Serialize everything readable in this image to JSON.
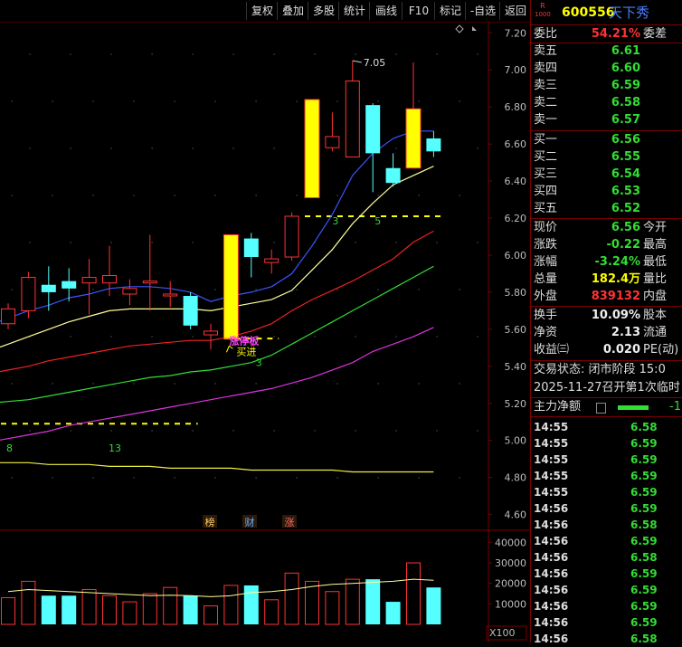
{
  "toolbar": {
    "items": [
      "复权",
      "叠加",
      "多股",
      "统计",
      "画线",
      "F10",
      "标记",
      "-自选",
      "返回"
    ]
  },
  "stock": {
    "badge_top": "R",
    "badge_bottom": "1000",
    "code": "600556",
    "name": "天下秀"
  },
  "weibi": {
    "label": "委比",
    "value": "54.21%",
    "label2": "委差"
  },
  "sells": [
    {
      "label": "卖五",
      "price": "6.61"
    },
    {
      "label": "卖四",
      "price": "6.60"
    },
    {
      "label": "卖三",
      "price": "6.59"
    },
    {
      "label": "卖二",
      "price": "6.58"
    },
    {
      "label": "卖一",
      "price": "6.57"
    }
  ],
  "buys": [
    {
      "label": "买一",
      "price": "6.56"
    },
    {
      "label": "买二",
      "price": "6.55"
    },
    {
      "label": "买三",
      "price": "6.54"
    },
    {
      "label": "买四",
      "price": "6.53"
    },
    {
      "label": "买五",
      "price": "6.52"
    }
  ],
  "quote": [
    {
      "label": "现价",
      "value": "6.56",
      "label2": "今开",
      "color": "green"
    },
    {
      "label": "涨跌",
      "value": "-0.22",
      "label2": "最高",
      "color": "green"
    },
    {
      "label": "涨幅",
      "value": "-3.24%",
      "label2": "最低",
      "color": "green"
    },
    {
      "label": "总量",
      "value": "182.4万",
      "label2": "量比",
      "color": "yellow"
    },
    {
      "label": "外盘",
      "value": "839132",
      "label2": "内盘",
      "color": "red"
    }
  ],
  "fundamentals": [
    {
      "label": "换手",
      "value": "10.09%",
      "label2": "股本"
    },
    {
      "label": "净资",
      "value": "2.13",
      "label2": "流通"
    },
    {
      "label": "收益㈢",
      "value": "0.020",
      "label2": "PE(动)"
    }
  ],
  "status": {
    "trade_state": "交易状态: 闭市阶段 15:0",
    "notice": "2025-11-27召开第1次临时",
    "main_flow_label": "主力净额",
    "main_flow_value": "-1"
  },
  "ticks": [
    {
      "time": "14:55",
      "price": "6.58"
    },
    {
      "time": "14:55",
      "price": "6.59"
    },
    {
      "time": "14:55",
      "price": "6.59"
    },
    {
      "time": "14:55",
      "price": "6.59"
    },
    {
      "time": "14:55",
      "price": "6.59"
    },
    {
      "time": "14:56",
      "price": "6.59"
    },
    {
      "time": "14:56",
      "price": "6.58"
    },
    {
      "time": "14:56",
      "price": "6.59"
    },
    {
      "time": "14:56",
      "price": "6.58"
    },
    {
      "time": "14:56",
      "price": "6.59"
    },
    {
      "time": "14:56",
      "price": "6.59"
    },
    {
      "time": "14:56",
      "price": "6.59"
    },
    {
      "time": "14:56",
      "price": "6.59"
    },
    {
      "time": "14:56",
      "price": "6.58"
    }
  ],
  "chart_data": {
    "type": "candlestick",
    "price_axis": {
      "ticks": [
        "7.20",
        "7.00",
        "6.80",
        "6.60",
        "6.40",
        "6.20",
        "6.00",
        "5.80",
        "5.60",
        "5.40",
        "5.20",
        "5.00",
        "4.80",
        "4.60"
      ],
      "ylim": [
        4.52,
        7.26
      ]
    },
    "volume_axis": {
      "ticks": [
        "40000",
        "30000",
        "20000",
        "10000"
      ],
      "unit": "X100",
      "ylim": [
        0,
        45000
      ]
    },
    "candles": [
      {
        "o": 5.63,
        "c": 5.71,
        "h": 5.74,
        "l": 5.6,
        "vol": 13000
      },
      {
        "o": 5.7,
        "c": 5.88,
        "h": 5.91,
        "l": 5.66,
        "vol": 21000
      },
      {
        "o": 5.84,
        "c": 5.8,
        "h": 5.94,
        "l": 5.7,
        "vol": 14000
      },
      {
        "o": 5.86,
        "c": 5.82,
        "h": 5.93,
        "l": 5.75,
        "vol": 14000
      },
      {
        "o": 5.85,
        "c": 5.88,
        "h": 5.98,
        "l": 5.68,
        "vol": 17000
      },
      {
        "o": 5.85,
        "c": 5.89,
        "h": 6.05,
        "l": 5.78,
        "vol": 14000
      },
      {
        "o": 5.79,
        "c": 5.82,
        "h": 5.87,
        "l": 5.73,
        "vol": 11000
      },
      {
        "o": 5.85,
        "c": 5.86,
        "h": 6.11,
        "l": 5.7,
        "vol": 15000
      },
      {
        "o": 5.78,
        "c": 5.79,
        "h": 5.86,
        "l": 5.72,
        "vol": 18000
      },
      {
        "o": 5.78,
        "c": 5.62,
        "h": 5.8,
        "l": 5.6,
        "vol": 14000
      },
      {
        "o": 5.57,
        "c": 5.59,
        "h": 5.63,
        "l": 5.49,
        "vol": 9000
      },
      {
        "o": 5.55,
        "c": 6.11,
        "h": 6.11,
        "l": 5.55,
        "vol": 19000,
        "special": "limit_up"
      },
      {
        "o": 6.09,
        "c": 5.99,
        "h": 6.12,
        "l": 5.88,
        "vol": 19000
      },
      {
        "o": 5.96,
        "c": 5.98,
        "h": 6.03,
        "l": 5.9,
        "vol": 12000
      },
      {
        "o": 5.99,
        "c": 6.21,
        "h": 6.23,
        "l": 5.97,
        "vol": 25000
      },
      {
        "o": 6.31,
        "c": 6.84,
        "h": 6.84,
        "l": 6.31,
        "vol": 21000,
        "special": "limit_up"
      },
      {
        "o": 6.58,
        "c": 6.64,
        "h": 6.77,
        "l": 6.56,
        "vol": 16000
      },
      {
        "o": 6.53,
        "c": 6.94,
        "h": 7.05,
        "l": 6.53,
        "vol": 22000
      },
      {
        "o": 6.81,
        "c": 6.55,
        "h": 6.82,
        "l": 6.34,
        "vol": 22000
      },
      {
        "o": 6.47,
        "c": 6.39,
        "h": 6.55,
        "l": 6.37,
        "vol": 11000
      },
      {
        "o": 6.47,
        "c": 6.79,
        "h": 7.04,
        "l": 6.47,
        "vol": 30000,
        "special": "limit_up"
      },
      {
        "o": 6.63,
        "c": 6.56,
        "h": 6.67,
        "l": 6.53,
        "vol": 18000
      }
    ],
    "ma_lines": [
      {
        "color": "#3a55ff",
        "values": [
          5.66,
          5.7,
          5.73,
          5.77,
          5.79,
          5.82,
          5.83,
          5.83,
          5.82,
          5.8,
          5.75,
          5.78,
          5.8,
          5.83,
          5.9,
          6.05,
          6.22,
          6.43,
          6.55,
          6.63,
          6.67,
          6.67
        ]
      },
      {
        "color": "#ffff99",
        "values": [
          5.52,
          5.56,
          5.6,
          5.64,
          5.67,
          5.7,
          5.71,
          5.71,
          5.71,
          5.71,
          5.7,
          5.72,
          5.74,
          5.76,
          5.81,
          5.92,
          6.03,
          6.17,
          6.28,
          6.38,
          6.43,
          6.48
        ]
      },
      {
        "color": "#ee2222",
        "values": [
          5.38,
          5.4,
          5.43,
          5.45,
          5.47,
          5.49,
          5.51,
          5.52,
          5.53,
          5.54,
          5.54,
          5.56,
          5.59,
          5.63,
          5.7,
          5.76,
          5.81,
          5.86,
          5.92,
          5.98,
          6.07,
          6.13
        ]
      },
      {
        "color": "#33dd33",
        "values": [
          5.21,
          5.22,
          5.24,
          5.26,
          5.28,
          5.3,
          5.32,
          5.34,
          5.35,
          5.37,
          5.38,
          5.4,
          5.42,
          5.46,
          5.52,
          5.58,
          5.64,
          5.7,
          5.76,
          5.82,
          5.88,
          5.94
        ]
      },
      {
        "color": "#dd33dd",
        "values": [
          5.01,
          5.03,
          5.05,
          5.08,
          5.1,
          5.12,
          5.14,
          5.16,
          5.18,
          5.2,
          5.22,
          5.24,
          5.26,
          5.28,
          5.31,
          5.34,
          5.38,
          5.42,
          5.48,
          5.52,
          5.56,
          5.61
        ]
      },
      {
        "color": "#eeee44",
        "values": [
          4.88,
          4.88,
          4.87,
          4.87,
          4.87,
          4.86,
          4.86,
          4.86,
          4.85,
          4.85,
          4.85,
          4.85,
          4.84,
          4.84,
          4.84,
          4.84,
          4.84,
          4.83,
          4.83,
          4.83,
          4.83,
          4.83
        ]
      }
    ],
    "volume_ma": [
      16000,
      17000,
      16500,
      16000,
      15500,
      15000,
      14500,
      14000,
      14200,
      14000,
      13500,
      14000,
      15500,
      16000,
      17000,
      18500,
      19500,
      20000,
      20500,
      21000,
      22000,
      21500
    ],
    "dashed_levels": [
      {
        "price": 6.21,
        "from": 15,
        "to": 21
      },
      {
        "price": 5.55,
        "from": 11,
        "to": 13
      },
      {
        "price": 5.09,
        "from": 0,
        "to": 9
      }
    ],
    "annotations": {
      "high_label": "7.05",
      "buy_label": "买进",
      "zt_label": "涨停板",
      "num_3a": "3",
      "num_5": "5",
      "num_3b": "3",
      "num_8": "8",
      "num_13": "13",
      "tags": [
        "榜",
        "财",
        "涨"
      ]
    }
  }
}
